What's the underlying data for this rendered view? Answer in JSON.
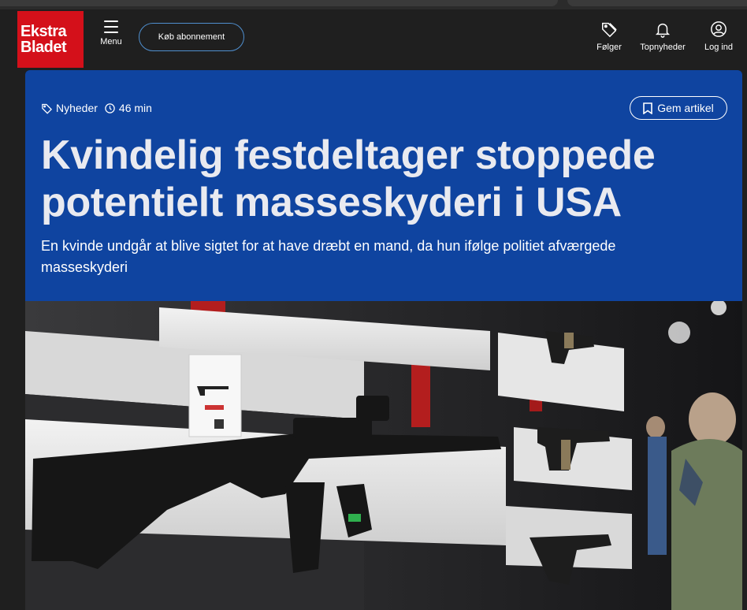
{
  "site": {
    "logo_line1": "Ekstra",
    "logo_line2": "Bladet",
    "menu_label": "Menu",
    "subscribe_label": "Køb abonnement"
  },
  "header_actions": [
    {
      "label": "Følger",
      "icon": "tag-icon"
    },
    {
      "label": "Topnyheder",
      "icon": "bell-icon"
    },
    {
      "label": "Log ind",
      "icon": "user-icon"
    }
  ],
  "article": {
    "category": "Nyheder",
    "age": "46 min",
    "save_label": "Gem artikel",
    "headline": "Kvindelig festdeltager stoppede potentielt masseskyderi i USA",
    "lede": "En kvinde undgår at blive sigtet for at have dræbt en mand, da hun ifølge politiet afværgede masseskyderi"
  },
  "colors": {
    "brand_red": "#d4101a",
    "hero_blue": "#0f44a0",
    "background": "#1f1f1f"
  }
}
